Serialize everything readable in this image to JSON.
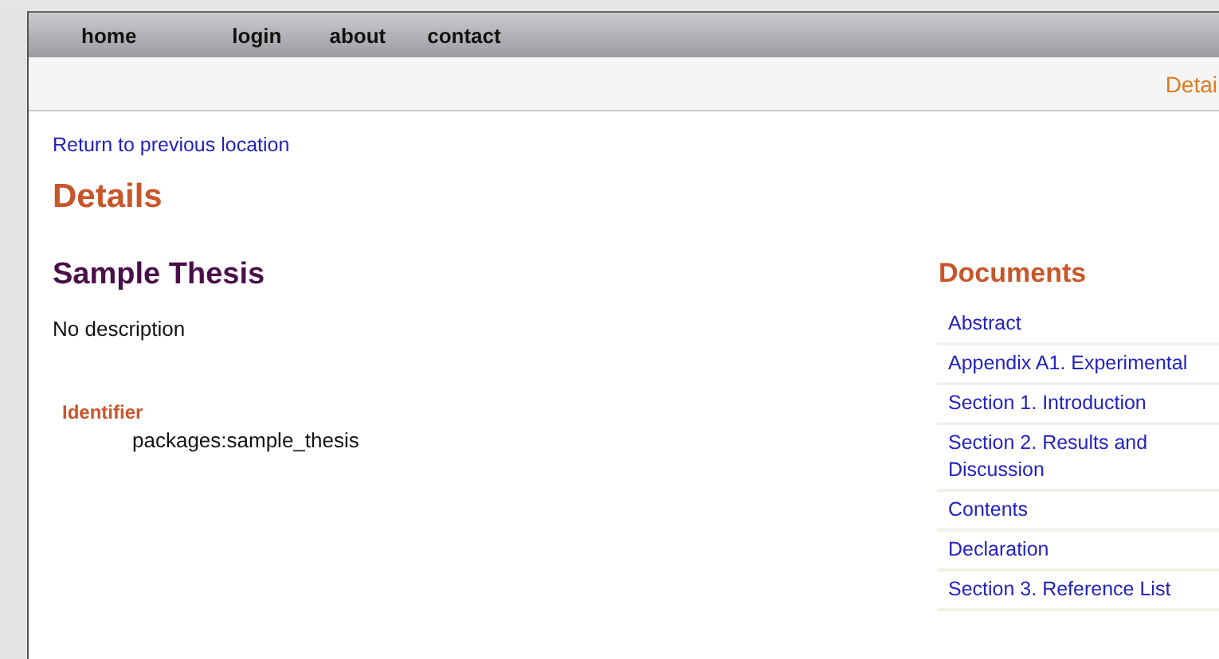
{
  "nav": [
    "home",
    "login",
    "about",
    "contact"
  ],
  "breadcrumb": "Detai",
  "back_link": "Return to previous location",
  "page_title": "Details",
  "item": {
    "title": "Sample Thesis",
    "description": "No description",
    "fields": [
      {
        "label": "Identifier",
        "value": "packages:sample_thesis"
      }
    ]
  },
  "documents": {
    "title": "Documents",
    "items": [
      "Abstract",
      "Appendix A1. Experimental",
      "Section 1. Introduction",
      "Section 2. Results and Discussion",
      "Contents",
      "Declaration",
      "Section 3. Reference List"
    ]
  }
}
